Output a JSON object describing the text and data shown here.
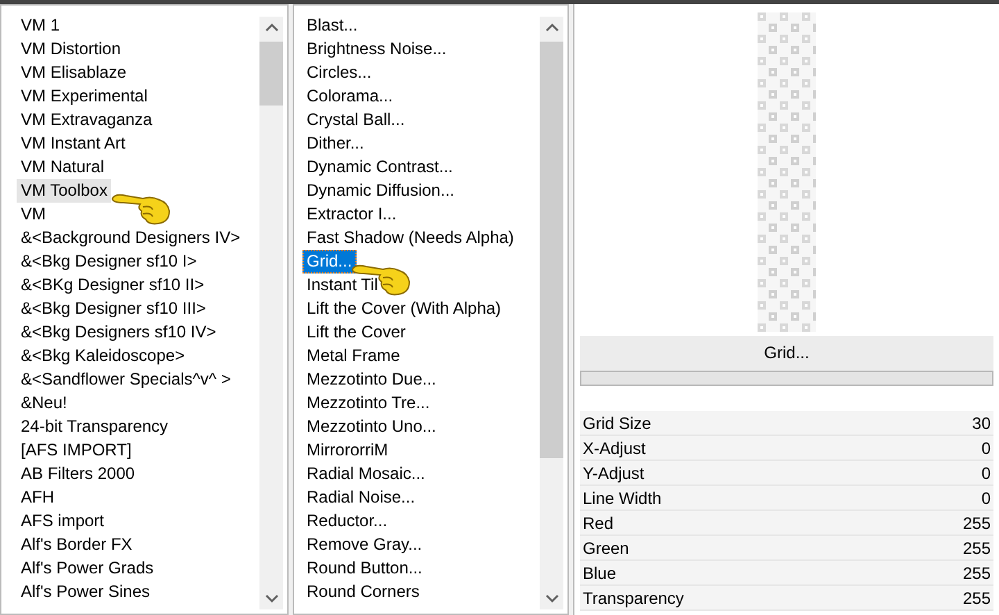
{
  "categories": {
    "items": [
      {
        "label": "VM 1",
        "selected": false
      },
      {
        "label": "VM Distortion",
        "selected": false
      },
      {
        "label": "VM Elisablaze",
        "selected": false
      },
      {
        "label": "VM Experimental",
        "selected": false
      },
      {
        "label": "VM Extravaganza",
        "selected": false
      },
      {
        "label": "VM Instant Art",
        "selected": false
      },
      {
        "label": "VM Natural",
        "selected": false
      },
      {
        "label": "VM Toolbox",
        "selected": true
      },
      {
        "label": "VM",
        "selected": false
      },
      {
        "label": "&<Background Designers IV>",
        "selected": false
      },
      {
        "label": "&<Bkg Designer sf10 I>",
        "selected": false
      },
      {
        "label": "&<BKg Designer sf10 II>",
        "selected": false
      },
      {
        "label": "&<Bkg Designer sf10 III>",
        "selected": false
      },
      {
        "label": "&<Bkg Designers sf10 IV>",
        "selected": false
      },
      {
        "label": "&<Bkg Kaleidoscope>",
        "selected": false
      },
      {
        "label": "&<Sandflower Specials^v^ >",
        "selected": false
      },
      {
        "label": "&Neu!",
        "selected": false
      },
      {
        "label": "24-bit Transparency",
        "selected": false
      },
      {
        "label": "[AFS IMPORT]",
        "selected": false
      },
      {
        "label": "AB Filters 2000",
        "selected": false
      },
      {
        "label": "AFH",
        "selected": false
      },
      {
        "label": "AFS import",
        "selected": false
      },
      {
        "label": "Alf's Border FX",
        "selected": false
      },
      {
        "label": "Alf's Power Grads",
        "selected": false
      },
      {
        "label": "Alf's Power Sines",
        "selected": false
      }
    ]
  },
  "filters": {
    "items": [
      {
        "label": "Blast...",
        "selected": false
      },
      {
        "label": "Brightness Noise...",
        "selected": false
      },
      {
        "label": "Circles...",
        "selected": false
      },
      {
        "label": "Colorama...",
        "selected": false
      },
      {
        "label": "Crystal Ball...",
        "selected": false
      },
      {
        "label": "Dither...",
        "selected": false
      },
      {
        "label": "Dynamic Contrast...",
        "selected": false
      },
      {
        "label": "Dynamic Diffusion...",
        "selected": false
      },
      {
        "label": "Extractor I...",
        "selected": false
      },
      {
        "label": "Fast Shadow (Needs Alpha)",
        "selected": false
      },
      {
        "label": "Grid...",
        "selected": true
      },
      {
        "label": "Instant Til",
        "selected": false
      },
      {
        "label": "Lift the Cover (With Alpha)",
        "selected": false
      },
      {
        "label": "Lift the Cover",
        "selected": false
      },
      {
        "label": "Metal Frame",
        "selected": false
      },
      {
        "label": "Mezzotinto Due...",
        "selected": false
      },
      {
        "label": "Mezzotinto Tre...",
        "selected": false
      },
      {
        "label": "Mezzotinto Uno...",
        "selected": false
      },
      {
        "label": "MirrororriM",
        "selected": false
      },
      {
        "label": "Radial Mosaic...",
        "selected": false
      },
      {
        "label": "Radial Noise...",
        "selected": false
      },
      {
        "label": "Reductor...",
        "selected": false
      },
      {
        "label": "Remove Gray...",
        "selected": false
      },
      {
        "label": "Round Button...",
        "selected": false
      },
      {
        "label": "Round Corners",
        "selected": false
      }
    ]
  },
  "settings": {
    "filter_title": "Grid...",
    "progress": {
      "level": 0
    },
    "params": [
      {
        "label": "Grid Size",
        "value": "30"
      },
      {
        "label": "X-Adjust",
        "value": "0"
      },
      {
        "label": "Y-Adjust",
        "value": "0"
      },
      {
        "label": "Line Width",
        "value": "0"
      },
      {
        "label": "Red",
        "value": "255"
      },
      {
        "label": "Green",
        "value": "255"
      },
      {
        "label": "Blue",
        "value": "255"
      },
      {
        "label": "Transparency",
        "value": "255"
      }
    ]
  }
}
